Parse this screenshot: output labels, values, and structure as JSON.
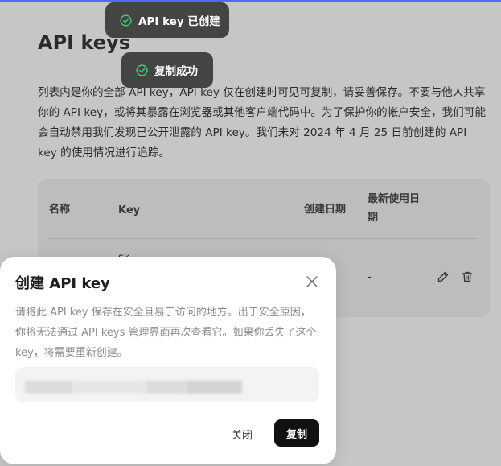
{
  "page": {
    "title": "API keys",
    "description": "列表内是你的全部 API key，API key 仅在创建时可见可复制，请妥善保存。不要与他人共享你的 API key，或将其暴露在浏览器或其他客户端代码中。为了保护你的帐户安全，我们可能会自动禁用我们发现已公开泄露的 API key。我们未对 2024 年 4 月 25 日前创建的 API key 的使用情况进行追踪。"
  },
  "table": {
    "headers": {
      "name": "名称",
      "key": "Key",
      "created": "创建日期",
      "last_used": "最新使用日期"
    },
    "rows": [
      {
        "key": "sk-",
        "created": "-",
        "last_used": "-"
      }
    ]
  },
  "toasts": [
    {
      "text": "API key 已创建",
      "icon": "check-circle-icon"
    },
    {
      "text": "复制成功",
      "icon": "check-circle-icon"
    }
  ],
  "modal": {
    "title": "创建 API key",
    "description": "请将此 API key 保存在安全且易于访问的地方。出于安全原因，你将无法通过 API keys 管理界面再次查看它。如果你丢失了这个 key，将需要重新创建。",
    "key_value_redacted": true,
    "close_label": "关闭",
    "copy_label": "复制"
  },
  "colors": {
    "accent": "#4d6bfe",
    "toast_bg": "#444444",
    "toast_check": "#3ccf74",
    "overlay_bg": "#c6c6c6",
    "primary_button": "#111111"
  }
}
